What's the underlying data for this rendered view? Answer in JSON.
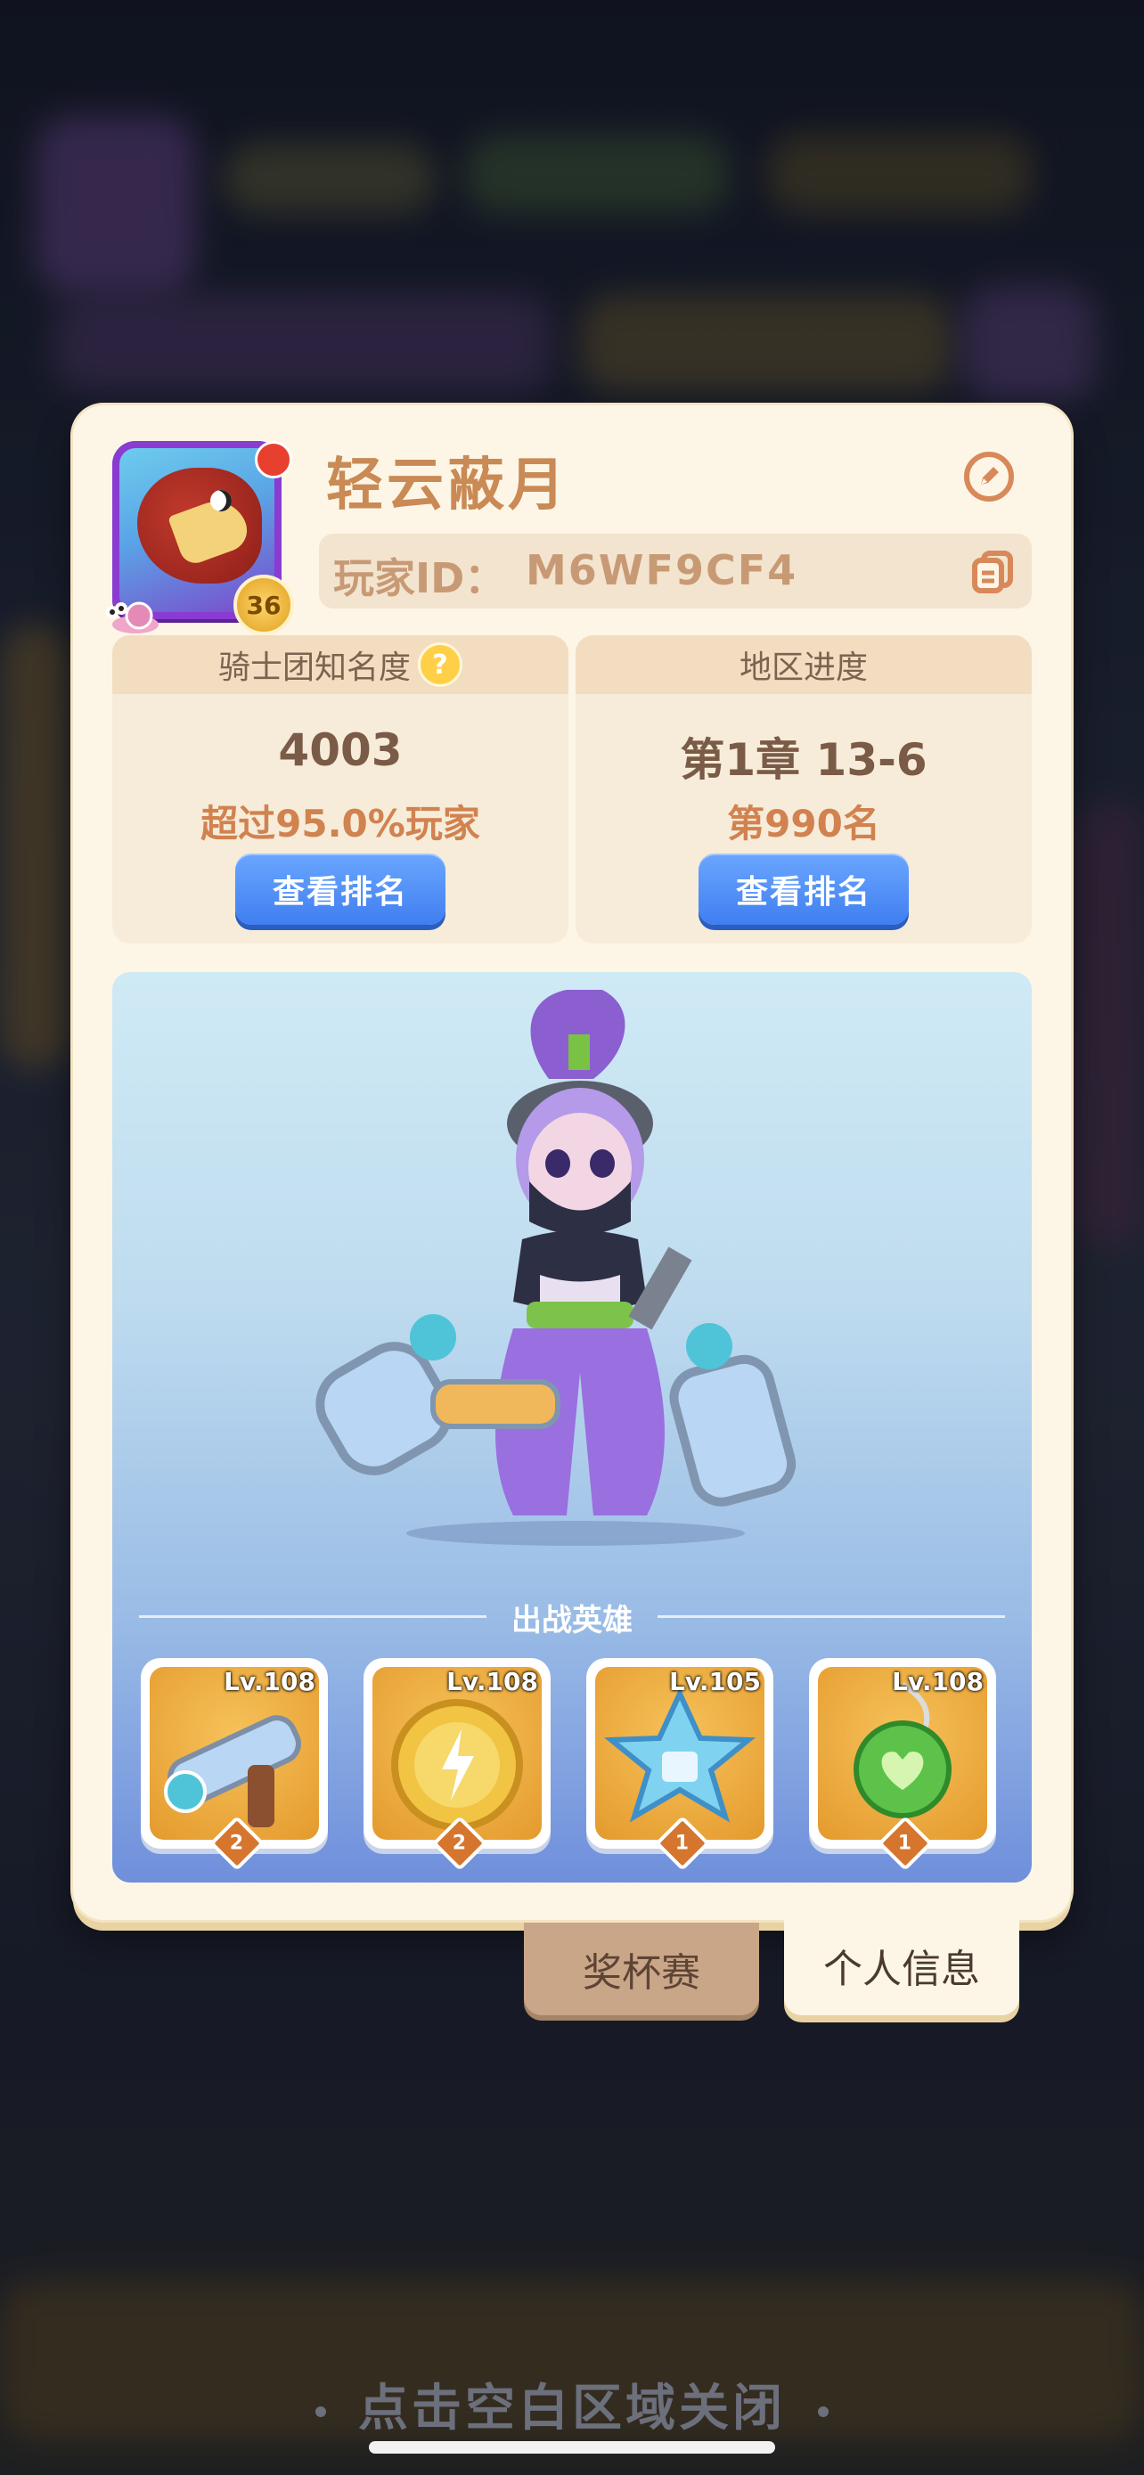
{
  "player": {
    "name": "轻云蔽月",
    "level": "36",
    "id_label": "玩家ID：",
    "id_value": "M6WF9CF4"
  },
  "fame": {
    "title": "骑士团知名度",
    "help_icon": "?",
    "value": "4003",
    "rank_text": "超过95.0%玩家",
    "button": "查看排名"
  },
  "region": {
    "title": "地区进度",
    "chapter": "第1章 13-6",
    "rank_text": "第990名",
    "button": "查看排名"
  },
  "team": {
    "title": "出战英雄",
    "heroes": [
      {
        "level": "Lv.108",
        "stars": "2",
        "icon": "blaster-cannon-icon"
      },
      {
        "level": "Lv.108",
        "stars": "2",
        "icon": "lightning-coin-icon"
      },
      {
        "level": "Lv.105",
        "stars": "1",
        "icon": "ice-star-icon"
      },
      {
        "level": "Lv.108",
        "stars": "1",
        "icon": "green-heart-amulet-icon"
      }
    ]
  },
  "tabs": {
    "trophy": "奖杯赛",
    "profile": "个人信息"
  },
  "close_hint": "点击空白区域关闭",
  "colors": {
    "panel": "#fdf6e6",
    "name": "#c98a55",
    "button_blue": "#3f7ff0",
    "highlight": "#d1824f"
  }
}
